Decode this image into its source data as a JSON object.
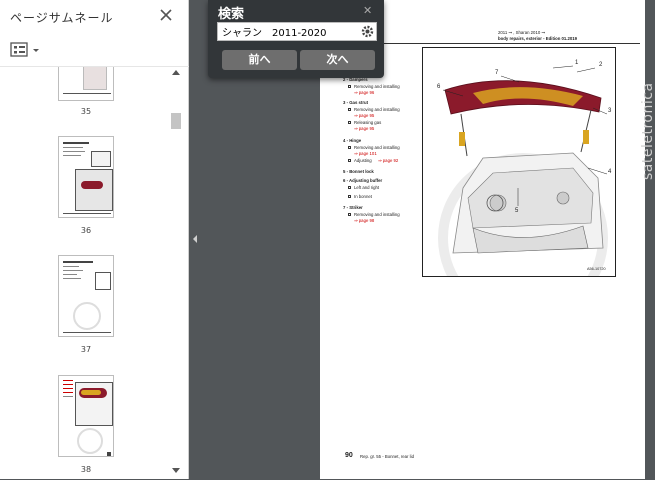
{
  "sidebar": {
    "title": "ページサムネール",
    "pages": [
      {
        "label": "35"
      },
      {
        "label": "36"
      },
      {
        "label": "37"
      },
      {
        "label": "38"
      }
    ]
  },
  "search": {
    "title": "検索",
    "value": "シャラン　2011-2020",
    "prev_label": "前へ",
    "next_label": "次へ"
  },
  "document": {
    "header_line1": "2011 ➞ , Sharan 2010 ➞",
    "header_line2": "body repairs, exterior - Edition 01.2019",
    "items": [
      {
        "title": "2 - Dampers",
        "subs": [
          {
            "text": "Removing and installing",
            "link": "⇒ page 96"
          }
        ]
      },
      {
        "title": "3 - Gas strut",
        "subs": [
          {
            "text": "Removing and installing",
            "link": "⇒ page 95"
          },
          {
            "text": "Releasing gas",
            "link": "⇒ page 95"
          }
        ]
      },
      {
        "title": "4 - Hinge",
        "subs": [
          {
            "text": "Removing and installing",
            "link": "⇒ page 101"
          },
          {
            "text": "Adjusting",
            "link": "⇒ page 92"
          }
        ]
      },
      {
        "title": "5 - Bonnet lock",
        "subs": []
      },
      {
        "title": "6 - Adjusting buffer",
        "subs": [
          {
            "text": "Left and right",
            "link": ""
          },
          {
            "text": "In bonnet",
            "link": ""
          }
        ]
      },
      {
        "title": "7 - Striker",
        "subs": [
          {
            "text": "Removing and installing",
            "link": "⇒ page 98"
          }
        ]
      }
    ],
    "top_link": "⇒ page 97",
    "figure_code": "A56-10720",
    "callouts": [
      "1",
      "2",
      "3",
      "4",
      "5",
      "6",
      "7"
    ],
    "footer_page": "90",
    "footer_text": "Rep. gr. 55 - Bonnet, rear lid",
    "watermark": "sateletronica"
  },
  "colors": {
    "accent": "#8b1a2b",
    "panel": "#323639",
    "viewer_bg": "#525659"
  }
}
